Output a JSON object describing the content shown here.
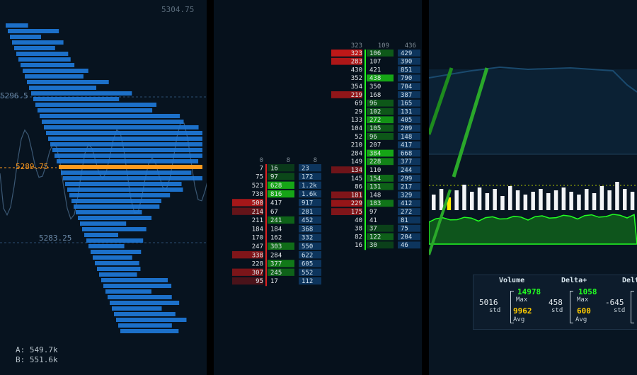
{
  "profile": {
    "top_price": "5304.75",
    "price_high": "5296.5",
    "poc_price": "5289.75",
    "price_low": "5283.25",
    "ask_volume": "A: 549.7k",
    "bid_volume": "B: 551.6k",
    "poc_color": "#ff9a1e",
    "bar_color": "#1e78d8"
  },
  "ladder_left": {
    "header": [
      "0",
      "8",
      "8"
    ],
    "rows": [
      {
        "bid": "7",
        "ask": "16",
        "vol": "23"
      },
      {
        "bid": "75",
        "ask": "97",
        "vol": "172"
      },
      {
        "bid": "523",
        "ask": "628",
        "vol": "1.2k"
      },
      {
        "bid": "738",
        "ask": "816",
        "vol": "1.6k"
      },
      {
        "bid": "500",
        "ask": "417",
        "vol": "917"
      },
      {
        "bid": "214",
        "ask": "67",
        "vol": "281"
      },
      {
        "bid": "211",
        "ask": "241",
        "vol": "452"
      },
      {
        "bid": "184",
        "ask": "184",
        "vol": "368"
      },
      {
        "bid": "170",
        "ask": "162",
        "vol": "332"
      },
      {
        "bid": "247",
        "ask": "303",
        "vol": "550"
      },
      {
        "bid": "338",
        "ask": "284",
        "vol": "622"
      },
      {
        "bid": "228",
        "ask": "377",
        "vol": "605"
      },
      {
        "bid": "307",
        "ask": "245",
        "vol": "552"
      },
      {
        "bid": "95",
        "ask": "17",
        "vol": "112"
      }
    ]
  },
  "ladder_right": {
    "header": [
      "323",
      "109",
      "436"
    ],
    "rows": [
      {
        "bid": "323",
        "ask": "106",
        "vol": "429"
      },
      {
        "bid": "283",
        "ask": "107",
        "vol": "390"
      },
      {
        "bid": "430",
        "ask": "421",
        "vol": "851"
      },
      {
        "bid": "352",
        "ask": "438",
        "vol": "790"
      },
      {
        "bid": "354",
        "ask": "350",
        "vol": "704"
      },
      {
        "bid": "219",
        "ask": "168",
        "vol": "387"
      },
      {
        "bid": "69",
        "ask": "96",
        "vol": "165"
      },
      {
        "bid": "29",
        "ask": "102",
        "vol": "131"
      },
      {
        "bid": "133",
        "ask": "272",
        "vol": "405"
      },
      {
        "bid": "104",
        "ask": "105",
        "vol": "209"
      },
      {
        "bid": "52",
        "ask": "96",
        "vol": "148"
      },
      {
        "bid": "210",
        "ask": "207",
        "vol": "417"
      },
      {
        "bid": "284",
        "ask": "384",
        "vol": "668"
      },
      {
        "bid": "149",
        "ask": "228",
        "vol": "377"
      },
      {
        "bid": "134",
        "ask": "110",
        "vol": "244"
      },
      {
        "bid": "145",
        "ask": "154",
        "vol": "299"
      },
      {
        "bid": "86",
        "ask": "131",
        "vol": "217"
      },
      {
        "bid": "181",
        "ask": "148",
        "vol": "329"
      },
      {
        "bid": "229",
        "ask": "183",
        "vol": "412"
      },
      {
        "bid": "175",
        "ask": "97",
        "vol": "272"
      },
      {
        "bid": "40",
        "ask": "41",
        "vol": "81"
      },
      {
        "bid": "38",
        "ask": "37",
        "vol": "75"
      },
      {
        "bid": "82",
        "ask": "122",
        "vol": "204"
      },
      {
        "bid": "16",
        "ask": "30",
        "vol": "46"
      }
    ]
  },
  "stats": {
    "headers": [
      "Volume",
      "Delta+",
      "Delt"
    ],
    "volume": {
      "std_value": "5016",
      "std_label": "std",
      "max_label": "Max",
      "max_value": "14978",
      "avg_value": "9962",
      "avg_label": "Avg"
    },
    "delta": {
      "std_value": "458",
      "std_label": "std",
      "max_label": "Max",
      "max_value": "1058",
      "avg_value": "600",
      "avg_label": "Avg"
    },
    "delta_neg": {
      "std_value": "-645",
      "std_label": "std"
    }
  },
  "colors": {
    "buy": "#16a516",
    "sell": "#c01818",
    "highlight_buy": "#22ff22",
    "highlight_sell": "#ff2222",
    "accent_blue": "#1e78d8",
    "avg_yellow": "#ffcc00"
  }
}
